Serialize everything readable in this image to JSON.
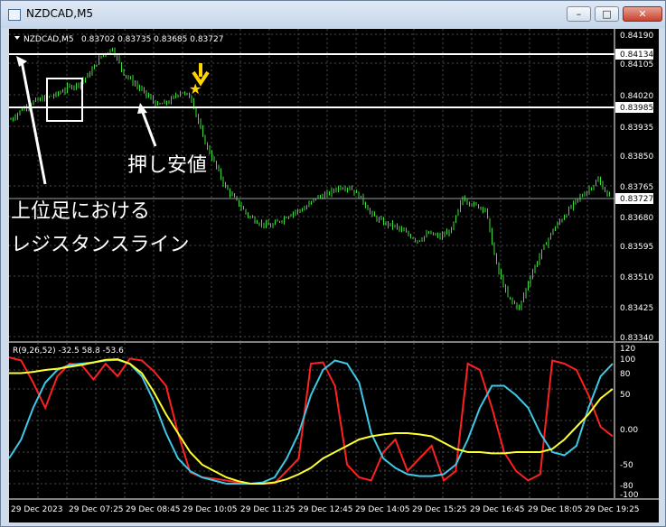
{
  "window": {
    "title": "NZDCAD,M5",
    "icon": "chart-window-icon",
    "buttons": {
      "minimize": "–",
      "maximize": "□",
      "close": "✕"
    }
  },
  "chart_header": {
    "symbol": "NZDCAD,M5",
    "ohlc": "0.83702 0.83735 0.83685 0.83727"
  },
  "price_axis": {
    "ticks": [
      "0.84190",
      "0.84105",
      "0.84020",
      "0.83935",
      "0.83850",
      "0.83765",
      "0.83680",
      "0.83595",
      "0.83510",
      "0.83425",
      "0.83340"
    ],
    "resistance_label": "0.84134",
    "support_label": "0.83985",
    "current_label": "0.83727"
  },
  "annotations": {
    "pullback": "押し安値",
    "resistance_line1": "上位足における",
    "resistance_line2": "レジスタンスライン",
    "star": "★"
  },
  "indicator": {
    "header": "R(9,26,52) -32.5 58.8 -53.6",
    "ticks": [
      "120",
      "100",
      "80",
      "50",
      "0.00",
      "-50",
      "-80",
      "-100"
    ]
  },
  "time_axis": [
    "29 Dec 2023",
    "29 Dec 07:25",
    "29 Dec 08:45",
    "29 Dec 10:05",
    "29 Dec 11:25",
    "29 Dec 12:45",
    "29 Dec 14:05",
    "29 Dec 15:25",
    "29 Dec 16:45",
    "29 Dec 18:05",
    "29 Dec 19:25"
  ],
  "chart_data": [
    {
      "type": "candlestick",
      "title": "NZDCAD,M5",
      "ylim": [
        0.8334,
        0.8419
      ],
      "price_path": [
        [
          0,
          0.8395
        ],
        [
          5,
          0.8398
        ],
        [
          10,
          0.84
        ],
        [
          15,
          0.8401
        ],
        [
          20,
          0.8402
        ],
        [
          25,
          0.8404
        ],
        [
          30,
          0.8405
        ],
        [
          35,
          0.8408
        ],
        [
          40,
          0.8413
        ],
        [
          45,
          0.8415
        ],
        [
          50,
          0.8408
        ],
        [
          55,
          0.8405
        ],
        [
          60,
          0.8402
        ],
        [
          65,
          0.8399
        ],
        [
          70,
          0.84
        ],
        [
          75,
          0.8403
        ],
        [
          80,
          0.8401
        ],
        [
          85,
          0.839
        ],
        [
          90,
          0.8383
        ],
        [
          95,
          0.8376
        ],
        [
          100,
          0.8372
        ],
        [
          105,
          0.8368
        ],
        [
          110,
          0.8366
        ],
        [
          115,
          0.8365
        ],
        [
          120,
          0.8367
        ],
        [
          125,
          0.8369
        ],
        [
          130,
          0.837
        ],
        [
          135,
          0.8373
        ],
        [
          140,
          0.8374
        ],
        [
          145,
          0.8376
        ],
        [
          150,
          0.8376
        ],
        [
          155,
          0.8373
        ],
        [
          160,
          0.8368
        ],
        [
          165,
          0.8366
        ],
        [
          170,
          0.8365
        ],
        [
          175,
          0.8363
        ],
        [
          180,
          0.8361
        ],
        [
          185,
          0.8363
        ],
        [
          190,
          0.8362
        ],
        [
          195,
          0.8364
        ],
        [
          200,
          0.8373
        ],
        [
          205,
          0.8371
        ],
        [
          210,
          0.837
        ],
        [
          215,
          0.8354
        ],
        [
          220,
          0.8345
        ],
        [
          225,
          0.8342
        ],
        [
          230,
          0.8351
        ],
        [
          235,
          0.8358
        ],
        [
          240,
          0.8364
        ],
        [
          245,
          0.8368
        ],
        [
          250,
          0.8372
        ],
        [
          255,
          0.8375
        ],
        [
          260,
          0.8378
        ],
        [
          265,
          0.8373
        ]
      ],
      "resistance_level": 0.84134,
      "support_level": 0.83985,
      "current_price": 0.83727
    },
    {
      "type": "line",
      "title": "R(9,26,52)",
      "ylim": [
        -120,
        120
      ],
      "series": [
        {
          "color": "#ff2020",
          "values": [
            100,
            95,
            60,
            20,
            70,
            90,
            88,
            65,
            90,
            70,
            98,
            95,
            78,
            55,
            -20,
            -82,
            -90,
            -92,
            -95,
            -98,
            -100,
            -100,
            -99,
            -80,
            -60,
            90,
            92,
            55,
            -70,
            -90,
            -95,
            -50,
            -30,
            -80,
            -60,
            -40,
            -95,
            -80,
            90,
            80,
            20,
            -50,
            -80,
            -95,
            -85,
            95,
            90,
            80,
            40,
            -10,
            -25
          ]
        },
        {
          "color": "#3ec8e6",
          "values": [
            -60,
            -30,
            20,
            60,
            80,
            88,
            90,
            92,
            95,
            96,
            90,
            70,
            30,
            -20,
            -60,
            -80,
            -90,
            -95,
            -100,
            -100,
            -100,
            -98,
            -90,
            -60,
            -20,
            40,
            80,
            95,
            90,
            60,
            -20,
            -60,
            -75,
            -85,
            -88,
            -88,
            -85,
            -70,
            -30,
            20,
            55,
            55,
            40,
            20,
            -20,
            -50,
            -55,
            -40,
            20,
            70,
            90
          ]
        },
        {
          "color": "#ffff30",
          "values": [
            75,
            75,
            77,
            80,
            82,
            85,
            88,
            92,
            96,
            97,
            90,
            75,
            45,
            10,
            -20,
            -50,
            -70,
            -80,
            -90,
            -96,
            -100,
            -100,
            -98,
            -93,
            -85,
            -75,
            -60,
            -50,
            -40,
            -30,
            -25,
            -22,
            -20,
            -20,
            -22,
            -25,
            -35,
            -45,
            -50,
            -50,
            -52,
            -52,
            -50,
            -50,
            -50,
            -45,
            -30,
            -10,
            10,
            35,
            50
          ]
        }
      ]
    }
  ]
}
